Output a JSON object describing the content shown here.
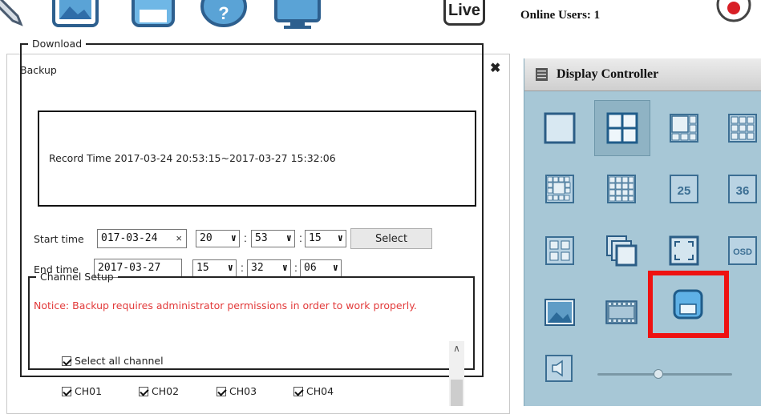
{
  "toolbar": {
    "icons": [
      "pen-icon",
      "image-icon",
      "save-icon",
      "help-icon",
      "monitor-icon"
    ],
    "live_label": "Live",
    "online_users": "Online Users: 1"
  },
  "backup": {
    "title": "Backup",
    "download_legend": "Download",
    "record_time": "Record Time 2017-03-24 20:53:15~2017-03-27 15:32:06",
    "start_label": "Start time",
    "start_date": "017-03-24",
    "start_hour": "20",
    "start_min": "53",
    "start_sec": "15",
    "select_label": "Select",
    "end_label": "End time",
    "end_date": "2017-03-27",
    "end_hour": "15",
    "end_min": "32",
    "end_sec": "06",
    "notice": "Notice: Backup requires administrator permissions in order to work properly.",
    "notice_color": "#e23a3a",
    "channel_legend": "Channel Setup",
    "select_all_label": "Select all channel",
    "channels": [
      "CH01",
      "CH02",
      "CH03",
      "CH04"
    ]
  },
  "display_controller": {
    "title": "Display Controller",
    "panel_color": "#a7c7d6",
    "highlight_color": "#ee1111",
    "tile_labels": {
      "layout25": "25",
      "layout36": "36",
      "osd": "OSD"
    }
  }
}
